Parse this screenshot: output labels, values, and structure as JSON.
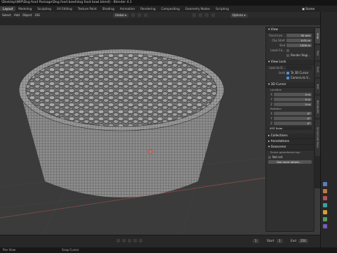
{
  "window": {
    "title": "\\Desktop\\WIP\\Dog food Package\\Dog food bowl\\dog food bowl.blend] - Blender 4.1"
  },
  "workspace_tabs": [
    {
      "label": "Layout",
      "active": true
    },
    {
      "label": "Modeling",
      "active": false
    },
    {
      "label": "Sculpting",
      "active": false
    },
    {
      "label": "UV Editing",
      "active": false
    },
    {
      "label": "Texture Paint",
      "active": false
    },
    {
      "label": "Shading",
      "active": false
    },
    {
      "label": "Animation",
      "active": false
    },
    {
      "label": "Rendering",
      "active": false
    },
    {
      "label": "Compositing",
      "active": false
    },
    {
      "label": "Geometry Nodes",
      "active": false
    },
    {
      "label": "Scripting",
      "active": false
    }
  ],
  "scene_label": "Scene",
  "header": {
    "menus": [
      "Select",
      "Add",
      "Object",
      "GIS"
    ],
    "transform_orientation": "Global",
    "options": "Options"
  },
  "npanel": {
    "view": {
      "title": "View",
      "focal_label": "Focal Len...",
      "focal_value": "50 mm",
      "clip_label": "Clip Start",
      "clip_start": "0.01 m",
      "end_label": "End",
      "clip_end": "1000 m",
      "local_label": "Local Ca...",
      "render_region": "Render Regi..."
    },
    "view_lock": {
      "title": "View Lock",
      "lock_to_label": "Lock to O...",
      "lock_label": "Lock",
      "to_3d_cursor": "To 3D Cursor",
      "camera_to_view": "Camera to V..."
    },
    "cursor": {
      "title": "3D Cursor",
      "location_label": "Location",
      "loc": [
        {
          "axis": "X",
          "value": "0 m"
        },
        {
          "axis": "Y",
          "value": "0 m"
        },
        {
          "axis": "Z",
          "value": "0 m"
        }
      ],
      "rotation_label": "Rotation",
      "rot": [
        {
          "axis": "X",
          "value": "0°"
        },
        {
          "axis": "Y",
          "value": "0°"
        },
        {
          "axis": "Z",
          "value": "0°"
        }
      ],
      "mode": "XYZ Euler"
    },
    "collections": "Collections",
    "annotations": "Annotations",
    "geo": {
      "title": "Geoscene",
      "sub": "Scene georeferencing :",
      "not_set": "Not set",
      "button": "See more details..."
    }
  },
  "side_tabs": [
    "View",
    "Tool",
    "Item",
    "Edit",
    "BlenderKit",
    "Screencast Keys"
  ],
  "timeline": {
    "current_frame": "1",
    "start_label": "Start",
    "start": "1",
    "end_label": "End",
    "end": "250"
  },
  "status": {
    "left": "Pan View",
    "right": "Snap Cursor"
  }
}
